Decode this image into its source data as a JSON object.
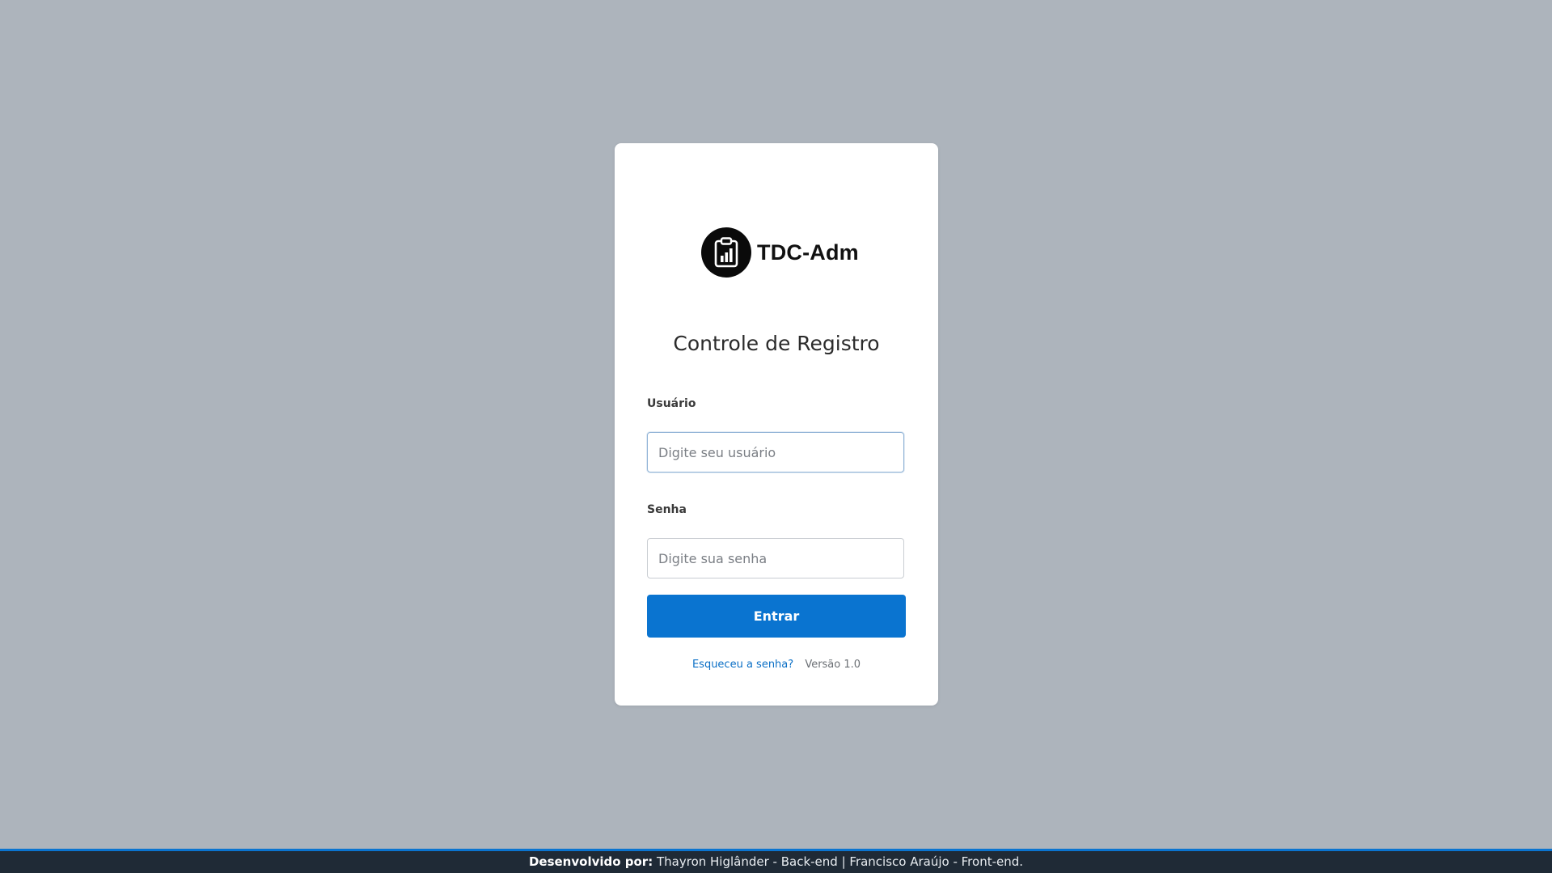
{
  "brand": {
    "name": "TDC-Adm",
    "icon": "clipboard-chart-icon"
  },
  "login": {
    "title": "Controle de Registro",
    "username_label": "Usuário",
    "username_placeholder": "Digite seu usuário",
    "username_value": "",
    "password_label": "Senha",
    "password_placeholder": "Digite sua senha",
    "password_value": "",
    "submit_label": "Entrar",
    "forgot_link": "Esqueceu a senha?",
    "version": "Versão 1.0"
  },
  "footer": {
    "prefix": "Desenvolvido por:",
    "credits": "Thayron Higlânder - Back-end | Francisco Araújo - Front-end."
  },
  "colors": {
    "background": "#adb4bc",
    "primary": "#0a74d0",
    "footer_bg": "#1f2a36",
    "link": "#0a6fc6"
  }
}
